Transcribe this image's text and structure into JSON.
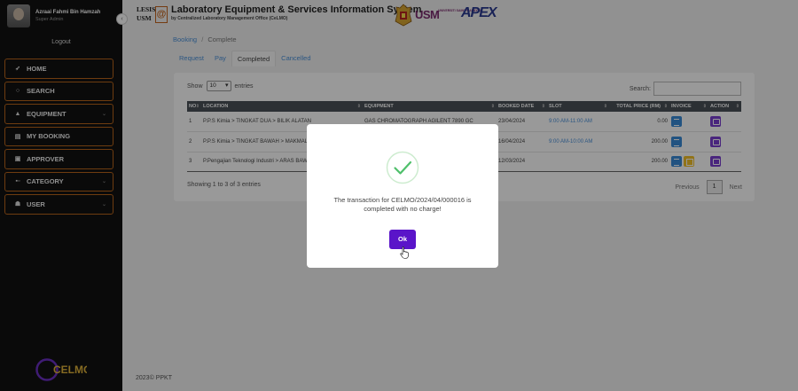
{
  "user": {
    "name": "Azraai Fahmi Bin Hamzah",
    "role": "Super Admin"
  },
  "sidebar": {
    "logout_label": "Logout",
    "items": [
      {
        "label": "HOME",
        "icon": "rocket-icon"
      },
      {
        "label": "SEARCH",
        "icon": "search-icon"
      },
      {
        "label": "EQUIPMENT",
        "icon": "flask-icon",
        "has_submenu": true
      },
      {
        "label": "MY BOOKING",
        "icon": "calendar-icon"
      },
      {
        "label": "APPROVER",
        "icon": "check-square-icon"
      },
      {
        "label": "CATEGORY",
        "icon": "grid-icon",
        "has_submenu": true
      },
      {
        "label": "USER",
        "icon": "users-icon",
        "has_submenu": true
      }
    ],
    "logo_text": "CELMO",
    "collapse_icon": "chevron-left-icon"
  },
  "header": {
    "lesis_top": "LESIS",
    "lesis_bottom": "USM",
    "at_mark": "@",
    "title": "Laboratory Equipment & Services Information System",
    "subtitle": "by Centralized Laboratory Management Office (CeLMO)",
    "usm_logo": "USM",
    "usm_sub": "UNIVERSITI SAINS MALAYSIA",
    "apex_logo": "APEX"
  },
  "breadcrumb": {
    "link": "Booking",
    "separator": "/",
    "current": "Complete"
  },
  "tabs": [
    {
      "label": "Request",
      "active": false
    },
    {
      "label": "Pay",
      "active": false
    },
    {
      "label": "Completed",
      "active": true
    },
    {
      "label": "Cancelled",
      "active": false
    }
  ],
  "table_controls": {
    "show_label": "Show",
    "page_size": "10",
    "entries_label": "entries",
    "search_label": "Search:"
  },
  "table": {
    "columns": [
      "NO",
      "LOCATION",
      "EQUIPMENT",
      "BOOKED DATE",
      "SLOT",
      "TOTAL PRICE (RM)",
      "INVOICE",
      "ACTION"
    ],
    "rows": [
      {
        "no": "1",
        "location": "P.P.S Kimia > TINGKAT DUA > BILIK ALATAN",
        "equipment": "GAS CHROMATOGRAPH AGILENT 7890 GC",
        "date": "23/04/2024",
        "slot": "9:00 AM-11:00 AM",
        "price": "0.00"
      },
      {
        "no": "2",
        "location": "P.P.S Kimia > TINGKAT BAWAH > MAKMAL",
        "equipment": "",
        "date": "16/04/2024",
        "slot": "9:00 AM-10:00 AM",
        "price": "200.00"
      },
      {
        "no": "3",
        "location": "P.Pengajian Teknologi Industri > ARAS BAWAH",
        "equipment": "",
        "date": "12/03/2024",
        "slot": "",
        "price": "200.00"
      }
    ]
  },
  "table_info": "Showing 1 to 3 of 3 entries",
  "pagination": {
    "previous": "Previous",
    "current": "1",
    "next": "Next"
  },
  "footer": {
    "year": "2023©",
    "org": "PPKT"
  },
  "modal": {
    "icon": "success-check-icon",
    "message": "The transaction for CELMO/2024/04/000016 is completed with no charge!",
    "ok_label": "Ok"
  },
  "colors": {
    "accent": "#5a14c9",
    "success": "#4fc06b",
    "sidebar_border": "#b8641c",
    "link": "#4a90d9"
  }
}
